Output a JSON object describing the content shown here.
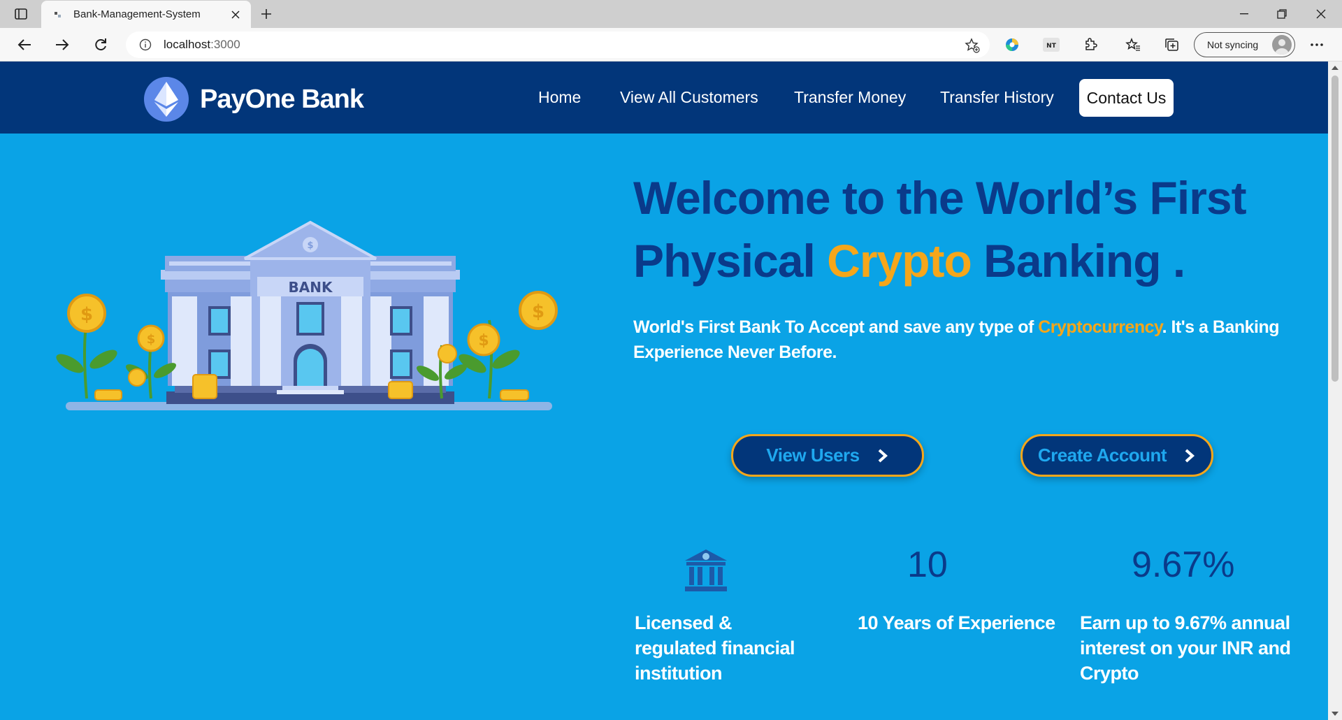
{
  "browser": {
    "tab_title": "Bank-Management-System",
    "url_host": "localhost",
    "url_port": ":3000",
    "sync_label": "Not syncing",
    "extension_label": "NT"
  },
  "navbar": {
    "brand": "PayOne Bank",
    "items": [
      "Home",
      "View All Customers",
      "Transfer Money",
      "Transfer History"
    ],
    "contact": "Contact Us"
  },
  "hero": {
    "title_line1": "Welcome to the World’s First",
    "title_line2_pre": "Physical ",
    "title_line2_accent": "Crypto",
    "title_line2_post": " Banking .",
    "sub_pre": "World's First Bank To Accept and save any type of ",
    "sub_accent": "Cryptocurrency",
    "sub_post": ". It's a Banking Experience Never Before.",
    "illustration_label": "BANK"
  },
  "buttons": {
    "view_users": "View Users",
    "create_account": "Create Account"
  },
  "stats": [
    {
      "value": "",
      "label": "Licensed & regulated financial institution"
    },
    {
      "value": "10",
      "label": "10 Years of Experience"
    },
    {
      "value": "9.67%",
      "label": "Earn up to 9.67% annual interest on your INR and Crypto"
    }
  ],
  "colors": {
    "page_bg": "#0aa3e6",
    "navbar_bg": "#02367a",
    "accent": "#f6a61a",
    "title": "#0a3a8a"
  }
}
